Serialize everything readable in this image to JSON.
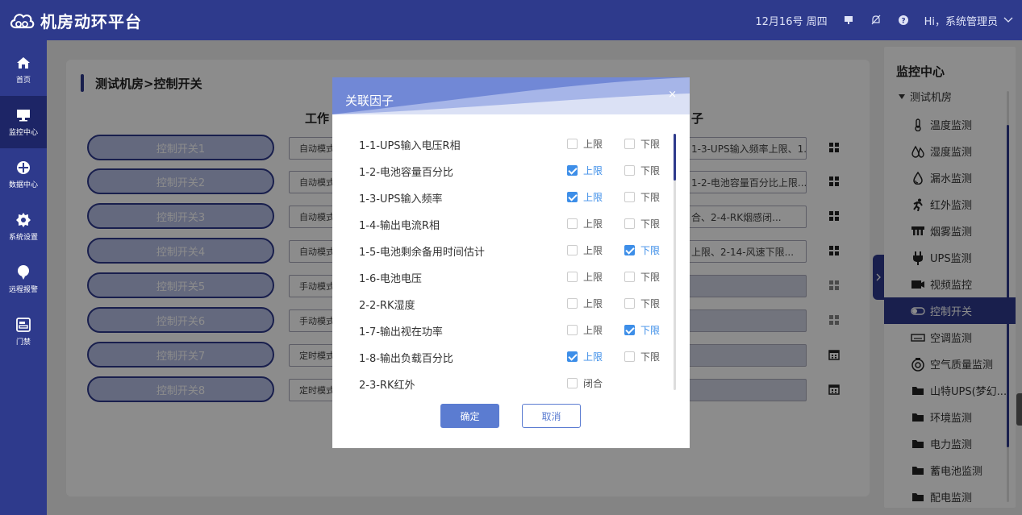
{
  "app": {
    "title": "机房动环平台"
  },
  "header": {
    "date": "12月16号 周四",
    "user": "Hi，系统管理员"
  },
  "leftnav": [
    {
      "label": "首页",
      "icon": "home-icon"
    },
    {
      "label": "监控中心",
      "icon": "monitor-icon",
      "active": true
    },
    {
      "label": "数据中心",
      "icon": "data-icon"
    },
    {
      "label": "系统设置",
      "icon": "gear-icon"
    },
    {
      "label": "远程报警",
      "icon": "alarm-icon"
    },
    {
      "label": "门禁",
      "icon": "door-icon"
    }
  ],
  "main": {
    "breadcrumb": "测试机房>控制开关",
    "col_work": "工作",
    "col_factor": "子",
    "rows": [
      {
        "name": "控制开关1",
        "mode": "自动模式",
        "factor": "1-3-UPS输入频率上限、1...",
        "icon": "grid-icon"
      },
      {
        "name": "控制开关2",
        "mode": "自动模式",
        "factor": "1-2-电池容量百分比上限...",
        "icon": "grid-icon"
      },
      {
        "name": "控制开关3",
        "mode": "自动模式",
        "factor": "合、2-4-RK烟感闭...",
        "icon": "grid-icon"
      },
      {
        "name": "控制开关4",
        "mode": "自动模式",
        "factor": "上限、2-14-风速下限...",
        "icon": "grid-icon"
      },
      {
        "name": "控制开关5",
        "mode": "手动模式",
        "factor": "",
        "icon": "grid-icon"
      },
      {
        "name": "控制开关6",
        "mode": "手动模式",
        "factor": "",
        "icon": "grid-icon"
      },
      {
        "name": "控制开关7",
        "mode": "定时模式",
        "factor": "",
        "icon": "calendar-icon"
      },
      {
        "name": "控制开关8",
        "mode": "定时模式",
        "factor": "",
        "icon": "calendar-icon"
      }
    ]
  },
  "right_panel": {
    "title": "监控中心",
    "root": "测试机房",
    "items": [
      {
        "label": "温度监测",
        "icon": "thermometer-icon"
      },
      {
        "label": "湿度监测",
        "icon": "humidity-icon"
      },
      {
        "label": "漏水监测",
        "icon": "water-drop-icon"
      },
      {
        "label": "红外监测",
        "icon": "running-person-icon"
      },
      {
        "label": "烟雾监测",
        "icon": "smoke-icon"
      },
      {
        "label": "UPS监测",
        "icon": "plug-icon"
      },
      {
        "label": "视频监控",
        "icon": "video-camera-icon"
      },
      {
        "label": "控制开关",
        "icon": "toggle-icon",
        "active": true
      },
      {
        "label": "空调监测",
        "icon": "air-conditioner-icon"
      },
      {
        "label": "空气质量监测",
        "icon": "air-quality-icon"
      },
      {
        "label": "山特UPS(梦幻...",
        "icon": "folder-icon"
      },
      {
        "label": "环境监测",
        "icon": "folder-icon"
      },
      {
        "label": "电力监测",
        "icon": "folder-icon"
      },
      {
        "label": "蓄电池监测",
        "icon": "folder-icon"
      },
      {
        "label": "配电监测",
        "icon": "folder-icon"
      }
    ]
  },
  "dialog": {
    "title": "关联因子",
    "close": "×",
    "upper_label": "上限",
    "lower_label": "下限",
    "closed_label": "闭合",
    "options": [
      {
        "name": "1-1-UPS输入电压R相",
        "upper": false,
        "lower": false
      },
      {
        "name": "1-2-电池容量百分比",
        "upper": true,
        "lower": false
      },
      {
        "name": "1-3-UPS输入频率",
        "upper": true,
        "lower": false
      },
      {
        "name": "1-4-输出电流R相",
        "upper": false,
        "lower": false
      },
      {
        "name": "1-5-电池剩余备用时间估计",
        "upper": false,
        "lower": true
      },
      {
        "name": "1-6-电池电压",
        "upper": false,
        "lower": false
      },
      {
        "name": "2-2-RK湿度",
        "upper": false,
        "lower": false
      },
      {
        "name": "1-7-输出视在功率",
        "upper": false,
        "lower": true
      },
      {
        "name": "1-8-输出负载百分比",
        "upper": true,
        "lower": false
      },
      {
        "name": "2-3-RK红外",
        "closed": false
      }
    ],
    "ok": "确定",
    "cancel": "取消"
  },
  "colors": {
    "primary": "#2e3a8c",
    "accent": "#3d8ee8",
    "button": "#5b7cd1"
  }
}
